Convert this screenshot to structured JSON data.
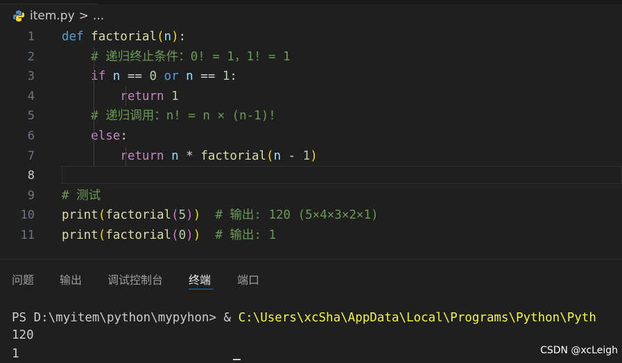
{
  "breadcrumb": {
    "file": "item.py",
    "separator": ">",
    "more": "..."
  },
  "editor": {
    "line_numbers": [
      "1",
      "2",
      "3",
      "4",
      "5",
      "6",
      "7",
      "8",
      "9",
      "10",
      "11"
    ],
    "active_line": "8",
    "lines": [
      [
        {
          "t": "def ",
          "c": "kw"
        },
        {
          "t": "factorial",
          "c": "fn"
        },
        {
          "t": "(",
          "c": "p1"
        },
        {
          "t": "n",
          "c": "var"
        },
        {
          "t": ")",
          "c": "p1"
        },
        {
          "t": ":",
          "c": "op"
        }
      ],
      [
        {
          "t": "    "
        },
        {
          "t": "# 递归终止条件：0! = 1，1! = 1",
          "c": "cmt"
        }
      ],
      [
        {
          "t": "    "
        },
        {
          "t": "if ",
          "c": "ctl"
        },
        {
          "t": "n",
          "c": "var"
        },
        {
          "t": " == ",
          "c": "op"
        },
        {
          "t": "0",
          "c": "num"
        },
        {
          "t": " or ",
          "c": "kw"
        },
        {
          "t": "n",
          "c": "var"
        },
        {
          "t": " == ",
          "c": "op"
        },
        {
          "t": "1",
          "c": "num"
        },
        {
          "t": ":",
          "c": "op"
        }
      ],
      [
        {
          "t": "        "
        },
        {
          "t": "return ",
          "c": "ctl"
        },
        {
          "t": "1",
          "c": "num"
        }
      ],
      [
        {
          "t": "    "
        },
        {
          "t": "# 递归调用：n! = n × (n-1)!",
          "c": "cmt"
        }
      ],
      [
        {
          "t": "    "
        },
        {
          "t": "else",
          "c": "ctl"
        },
        {
          "t": ":",
          "c": "op"
        }
      ],
      [
        {
          "t": "        "
        },
        {
          "t": "return ",
          "c": "ctl"
        },
        {
          "t": "n",
          "c": "var"
        },
        {
          "t": " * ",
          "c": "op"
        },
        {
          "t": "factorial",
          "c": "fn"
        },
        {
          "t": "(",
          "c": "p1"
        },
        {
          "t": "n",
          "c": "var"
        },
        {
          "t": " - ",
          "c": "op"
        },
        {
          "t": "1",
          "c": "num"
        },
        {
          "t": ")",
          "c": "p1"
        }
      ],
      [],
      [
        {
          "t": "# 测试",
          "c": "cmt"
        }
      ],
      [
        {
          "t": "print",
          "c": "fn"
        },
        {
          "t": "(",
          "c": "p1"
        },
        {
          "t": "factorial",
          "c": "fn"
        },
        {
          "t": "(",
          "c": "p2"
        },
        {
          "t": "5",
          "c": "num"
        },
        {
          "t": ")",
          "c": "p2"
        },
        {
          "t": ")",
          "c": "p1"
        },
        {
          "t": "  "
        },
        {
          "t": "# 输出: 120 (5×4×3×2×1)",
          "c": "cmt"
        }
      ],
      [
        {
          "t": "print",
          "c": "fn"
        },
        {
          "t": "(",
          "c": "p1"
        },
        {
          "t": "factorial",
          "c": "fn"
        },
        {
          "t": "(",
          "c": "p2"
        },
        {
          "t": "0",
          "c": "num"
        },
        {
          "t": ")",
          "c": "p2"
        },
        {
          "t": ")",
          "c": "p1"
        },
        {
          "t": "  "
        },
        {
          "t": "# 输出: 1",
          "c": "cmt"
        }
      ]
    ]
  },
  "panel": {
    "tabs": [
      "问题",
      "输出",
      "调试控制台",
      "终端",
      "端口"
    ],
    "active_tab": "终端"
  },
  "terminal": {
    "prompt": "PS D:\\myitem\\python\\mypyhon> ",
    "operator": "& ",
    "command_path": "C:\\Users\\xcSha\\AppData\\Local\\Programs\\Python\\Pyth",
    "output": [
      "120",
      "1"
    ]
  },
  "watermark": "CSDN @xcLeigh",
  "colors": {
    "background": "#1f1f1f",
    "keyword": "#569cd6",
    "control": "#c586c0",
    "function": "#dcdcaa",
    "variable": "#9cdcfe",
    "number": "#b5cea8",
    "comment": "#6a9955",
    "bracket1": "#ffd700",
    "bracket2": "#da70d6",
    "terminal_path": "#f5f543",
    "active_tab_underline": "#0078d4"
  }
}
